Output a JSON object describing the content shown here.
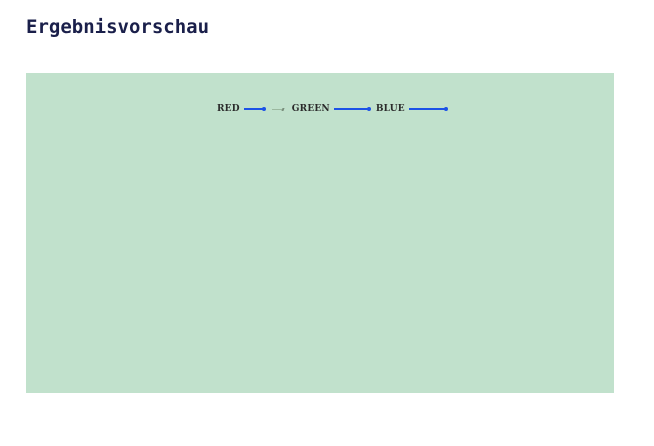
{
  "page": {
    "title": "Ergebnisvorschau"
  },
  "preview": {
    "background_color": "#c1e1cc",
    "connector_color": "#1c52e6",
    "chain": [
      {
        "label": "RED"
      },
      {
        "label": "GREEN"
      },
      {
        "label": "BLUE"
      }
    ]
  }
}
